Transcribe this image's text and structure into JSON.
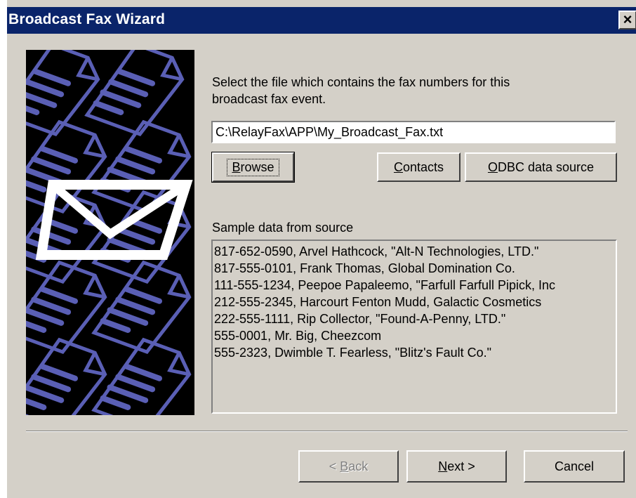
{
  "window": {
    "title": "Broadcast Fax Wizard",
    "close_glyph": "×"
  },
  "prompt": {
    "line1": "Select the file which contains the fax numbers for this",
    "line2": "broadcast fax event."
  },
  "file_path": {
    "value": "C:\\RelayFax\\APP\\My_Broadcast_Fax.txt"
  },
  "source_buttons": {
    "browse": {
      "mnemonic": "B",
      "rest": "rowse"
    },
    "contacts": {
      "mnemonic": "C",
      "rest": "ontacts"
    },
    "odbc": {
      "mnemonic": "O",
      "rest": "DBC data source"
    }
  },
  "sample": {
    "label": "Sample data from source",
    "rows": [
      "817-652-0590, Arvel Hathcock, \"Alt-N Technologies, LTD.\"",
      "817-555-0101, Frank Thomas, Global Domination Co.",
      "111-555-1234, Peepoe Papaleemo, \"Farfull Farfull Pipick, Inc",
      "212-555-2345, Harcourt Fenton Mudd, Galactic Cosmetics",
      "222-555-1111, Rip Collector, \"Found-A-Penny, LTD.\"",
      "555-0001, Mr. Big, Cheezcom",
      "555-2323, Dwimble T. Fearless, \"Blitz's Fault Co.\""
    ]
  },
  "nav": {
    "back": {
      "prefix": "< ",
      "mnemonic": "B",
      "rest": "ack",
      "enabled": false
    },
    "next": {
      "mnemonic": "N",
      "rest": "ext >"
    },
    "cancel": {
      "label": "Cancel"
    }
  },
  "colors": {
    "titlebar": "#0a246a",
    "face": "#d4d0c8",
    "art_background": "#000000",
    "art_pattern": "#5a5fb5",
    "envelope": "#ffffff"
  },
  "icons": {
    "side_art": "document-pattern-with-envelope",
    "close": "close-icon"
  }
}
